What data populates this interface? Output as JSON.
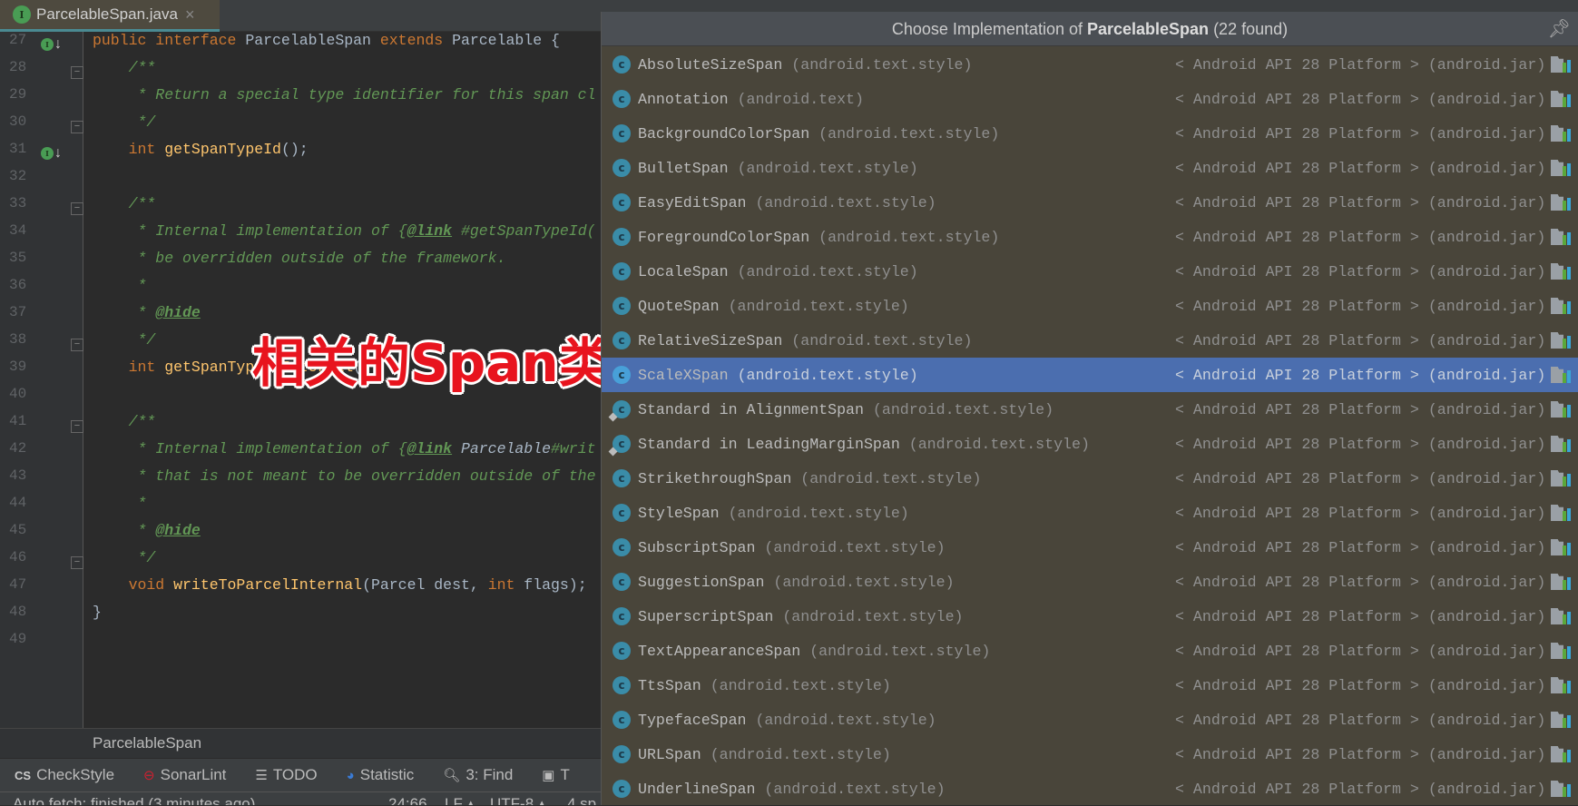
{
  "tab": {
    "title": "ParcelableSpan.java",
    "badge": "I",
    "close": "×"
  },
  "editor": {
    "lines": [
      {
        "n": "27",
        "marker": true,
        "fold": false,
        "tokens": [
          [
            "kw",
            "public interface "
          ],
          [
            "pr",
            "ParcelableSpan "
          ],
          [
            "kw",
            "extends "
          ],
          [
            "pr",
            "Parcelable {"
          ]
        ]
      },
      {
        "n": "28",
        "fold": true,
        "tokens": [
          [
            "cm",
            "    /**"
          ]
        ]
      },
      {
        "n": "29",
        "tokens": [
          [
            "cm",
            "     * Return a special type identifier for this span cl"
          ]
        ]
      },
      {
        "n": "30",
        "fold": true,
        "tokens": [
          [
            "cm",
            "     */"
          ]
        ]
      },
      {
        "n": "31",
        "marker": true,
        "tokens": [
          [
            "kw",
            "    int "
          ],
          [
            "fn",
            "getSpanTypeId"
          ],
          [
            "pr",
            "();"
          ]
        ]
      },
      {
        "n": "32",
        "tokens": []
      },
      {
        "n": "33",
        "fold": true,
        "tokens": [
          [
            "cm",
            "    /**"
          ]
        ]
      },
      {
        "n": "34",
        "tokens": [
          [
            "cm",
            "     * Internal implementation of {"
          ],
          [
            "tag",
            "@link"
          ],
          [
            "cm",
            " #getSpanTypeId("
          ]
        ]
      },
      {
        "n": "35",
        "tokens": [
          [
            "cm",
            "     * be overridden outside of the framework."
          ]
        ]
      },
      {
        "n": "36",
        "tokens": [
          [
            "cm",
            "     *"
          ]
        ]
      },
      {
        "n": "37",
        "tokens": [
          [
            "cm",
            "     * "
          ],
          [
            "tag",
            "@hide"
          ]
        ]
      },
      {
        "n": "38",
        "fold": true,
        "tokens": [
          [
            "cm",
            "     */"
          ]
        ]
      },
      {
        "n": "39",
        "tokens": [
          [
            "kw",
            "    int "
          ],
          [
            "fn",
            "getSpanTypeIdInternal"
          ],
          [
            "pr",
            "();"
          ]
        ]
      },
      {
        "n": "40",
        "tokens": []
      },
      {
        "n": "41",
        "fold": true,
        "tokens": [
          [
            "cm",
            "    /**"
          ]
        ]
      },
      {
        "n": "42",
        "tokens": [
          [
            "cm",
            "     * Internal implementation of {"
          ],
          [
            "tag",
            "@link"
          ],
          [
            "lk",
            " Parcelable"
          ],
          [
            "cm",
            "#writ"
          ]
        ]
      },
      {
        "n": "43",
        "tokens": [
          [
            "cm",
            "     * that is not meant to be overridden outside of the"
          ]
        ]
      },
      {
        "n": "44",
        "tokens": [
          [
            "cm",
            "     *"
          ]
        ]
      },
      {
        "n": "45",
        "tokens": [
          [
            "cm",
            "     * "
          ],
          [
            "tag",
            "@hide"
          ]
        ]
      },
      {
        "n": "46",
        "fold": true,
        "tokens": [
          [
            "cm",
            "     */"
          ]
        ]
      },
      {
        "n": "47",
        "tokens": [
          [
            "kw",
            "    void "
          ],
          [
            "fn",
            "writeToParcelInternal"
          ],
          [
            "pr",
            "(Parcel dest, "
          ],
          [
            "kw",
            "int "
          ],
          [
            "pr",
            "flags);"
          ]
        ]
      },
      {
        "n": "48",
        "tokens": [
          [
            "pr",
            "}"
          ]
        ]
      },
      {
        "n": "49",
        "tokens": []
      }
    ]
  },
  "overlay_text": "相关的Span类",
  "breadcrumb": "ParcelableSpan",
  "toolwindows": [
    {
      "icon": "checkstyle-icon",
      "glyph": "CS",
      "label": "CheckStyle"
    },
    {
      "icon": "sonarlint-icon",
      "glyph": "⊖",
      "label": "SonarLint"
    },
    {
      "icon": "todo-list-icon",
      "glyph": "☰",
      "label": "TODO"
    },
    {
      "icon": "statistic-icon",
      "glyph": "◕",
      "label": "Statistic"
    },
    {
      "icon": "search-icon",
      "glyph": "🔍︎",
      "label": "3: Find"
    },
    {
      "icon": "terminal-icon",
      "glyph": "▣",
      "label": "T"
    }
  ],
  "status": {
    "message": "Auto fetch: finished (3 minutes ago)",
    "position": "24:66",
    "line_sep": "LF ▴",
    "encoding": "UTF-8 ▴",
    "indent": "4 sp"
  },
  "popup": {
    "title_prefix": "Choose Implementation of ",
    "title_bold": "ParcelableSpan",
    "title_suffix": " (22 found)",
    "pin_icon": "pin-icon",
    "location": "< Android API 28 Platform > (android.jar)",
    "selected_index": 9,
    "items": [
      {
        "name": "AbsoluteSizeSpan",
        "pkg": "(android.text.style)"
      },
      {
        "name": "Annotation",
        "pkg": "(android.text)"
      },
      {
        "name": "BackgroundColorSpan",
        "pkg": "(android.text.style)"
      },
      {
        "name": "BulletSpan",
        "pkg": "(android.text.style)"
      },
      {
        "name": "EasyEditSpan",
        "pkg": "(android.text.style)"
      },
      {
        "name": "ForegroundColorSpan",
        "pkg": "(android.text.style)"
      },
      {
        "name": "LocaleSpan",
        "pkg": "(android.text.style)"
      },
      {
        "name": "QuoteSpan",
        "pkg": "(android.text.style)"
      },
      {
        "name": "RelativeSizeSpan",
        "pkg": "(android.text.style)"
      },
      {
        "name": "ScaleXSpan",
        "pkg": "(android.text.style)"
      },
      {
        "name": "Standard in AlignmentSpan",
        "pkg": "(android.text.style)",
        "inner": true
      },
      {
        "name": "Standard in LeadingMarginSpan",
        "pkg": "(android.text.style)",
        "inner": true
      },
      {
        "name": "StrikethroughSpan",
        "pkg": "(android.text.style)"
      },
      {
        "name": "StyleSpan",
        "pkg": "(android.text.style)"
      },
      {
        "name": "SubscriptSpan",
        "pkg": "(android.text.style)"
      },
      {
        "name": "SuggestionSpan",
        "pkg": "(android.text.style)"
      },
      {
        "name": "SuperscriptSpan",
        "pkg": "(android.text.style)"
      },
      {
        "name": "TextAppearanceSpan",
        "pkg": "(android.text.style)"
      },
      {
        "name": "TtsSpan",
        "pkg": "(android.text.style)"
      },
      {
        "name": "TypefaceSpan",
        "pkg": "(android.text.style)"
      },
      {
        "name": "URLSpan",
        "pkg": "(android.text.style)"
      },
      {
        "name": "UnderlineSpan",
        "pkg": "(android.text.style)"
      }
    ]
  },
  "colors": {
    "selection": "#4b6eaf",
    "popup_bg": "#49453a",
    "editor_bg": "#2b2b2b",
    "keyword": "#cc7832",
    "comment": "#629755"
  }
}
